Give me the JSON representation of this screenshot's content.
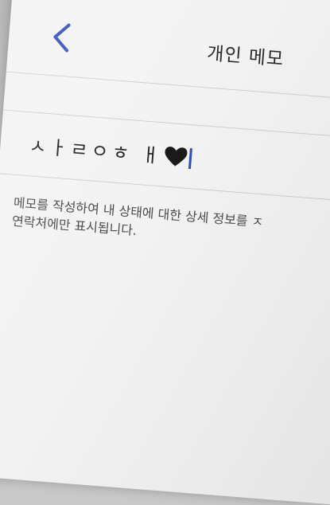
{
  "header": {
    "back_icon": "chevron-left-icon",
    "title": "개인 메모",
    "accent_color": "#2f4fb8"
  },
  "memo": {
    "value": "ㅅㅏㄹㅇㅎ ㅐ",
    "trailing_icon": "black-heart-icon"
  },
  "hint": {
    "line1": "메모를 작성하여 내 상태에 대한 상세 정보를 ㅈ",
    "line2": "연락처에만 표시됩니다."
  }
}
